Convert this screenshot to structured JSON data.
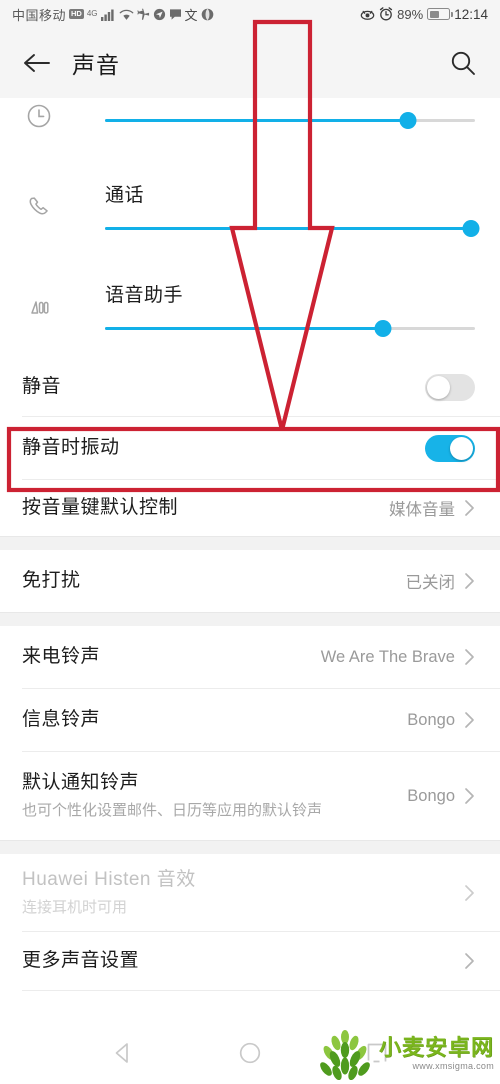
{
  "status_bar": {
    "carrier": "中国移动",
    "hd_badge": "HD",
    "network": "4G",
    "battery_percent": "89%",
    "time": "12:14",
    "icons": [
      "hd-icon",
      "signal-icon",
      "wifi-icon",
      "airplane-icon",
      "location-icon",
      "message-icon",
      "input-method-icon",
      "globe-icon",
      "eye-comfort-icon",
      "alarm-icon",
      "battery-icon"
    ]
  },
  "app_bar": {
    "title": "声音",
    "back_icon": "back-arrow-icon",
    "search_icon": "search-icon"
  },
  "volume_sliders": [
    {
      "icon": "alarm-clock-icon",
      "label": "",
      "value": 82
    },
    {
      "icon": "phone-call-icon",
      "label": "通话",
      "value": 99
    },
    {
      "icon": "voice-assistant-icon",
      "label": "语音助手",
      "value": 75
    }
  ],
  "toggles": [
    {
      "label": "静音",
      "state": "off"
    },
    {
      "label": "静音时振动",
      "state": "on",
      "highlighted": true
    }
  ],
  "list_items": [
    {
      "title": "按音量键默认控制",
      "value": "媒体音量",
      "chevron": true
    },
    {
      "title": "免打扰",
      "value": "已关闭",
      "chevron": true
    },
    {
      "title": "来电铃声",
      "value": "We Are The Brave",
      "chevron": true
    },
    {
      "title": "信息铃声",
      "value": "Bongo",
      "chevron": true
    },
    {
      "title": "默认通知铃声",
      "subtitle": "也可个性化设置邮件、日历等应用的默认铃声",
      "value": "Bongo",
      "chevron": true
    },
    {
      "title": "Huawei Histen 音效",
      "subtitle": "连接耳机时可用",
      "value": "",
      "chevron": true,
      "disabled": true
    },
    {
      "title": "更多声音设置",
      "value": "",
      "chevron": true
    }
  ],
  "nav_bar": {
    "back": "nav-back-icon",
    "home": "nav-home-icon",
    "recents": "nav-recents-icon"
  },
  "annotation": {
    "color": "#cc2233",
    "arrow": "down-arrow-outline",
    "highlight_box": "vibrate-on-silent-row"
  },
  "watermark": {
    "name": "小麦安卓网",
    "url": "www.xmsigma.com",
    "color": "#7ab51d"
  }
}
